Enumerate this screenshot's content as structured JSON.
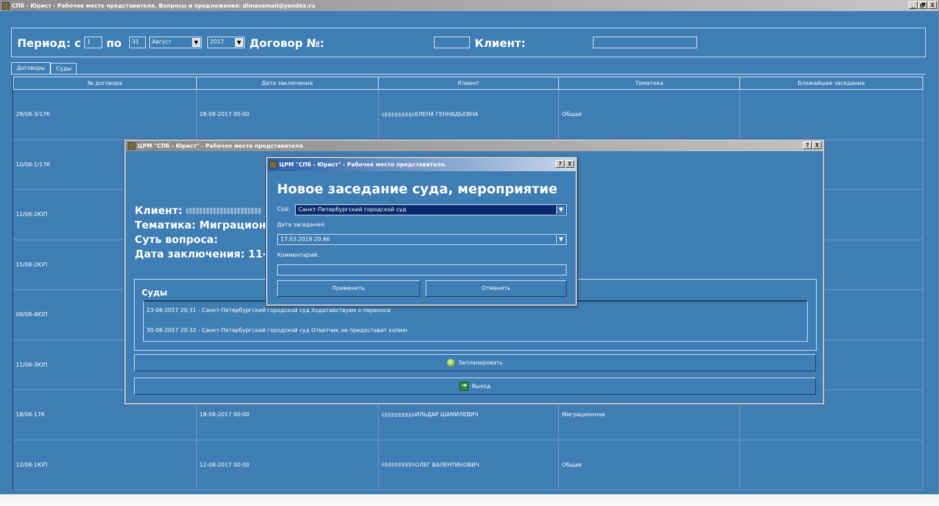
{
  "window": {
    "title": "СПб - Юрист - Рабочее место представителя. Вопросы и предложения: dimasemail@yandex.ru",
    "btn_min": "_",
    "btn_max": "🗗",
    "btn_close": "X"
  },
  "filter": {
    "period_from_label": "Период: с",
    "day_from": "1",
    "to_label": "по",
    "day_to": "31",
    "month": "Август",
    "year": "2017",
    "contract_label": "Договор №:",
    "contract_value": "",
    "client_label": "Клиент:",
    "client_value": ""
  },
  "tabs": [
    {
      "label": "Договоры",
      "active": true
    },
    {
      "label": "Суды",
      "active": false
    }
  ],
  "grid": {
    "columns": [
      "№ договора",
      "Дата заключения",
      "Клиент",
      "Тематика",
      "Ближайшее заседание"
    ],
    "rows": [
      {
        "num": "28/08-3/17К",
        "date": "28-08-2017 00:00",
        "client": "ЕЛЕНА ГЕННАДЬЕВНА",
        "topic": "Общая",
        "next": ""
      },
      {
        "num": "10/08-1/17К",
        "date": "",
        "client": "",
        "topic": "",
        "next": ""
      },
      {
        "num": "11/08-2ЮП",
        "date": "",
        "client": "",
        "topic": "",
        "next": ""
      },
      {
        "num": "15/08-2ЮП",
        "date": "",
        "client": "",
        "topic": "",
        "next": ""
      },
      {
        "num": "08/08-4ЮП",
        "date": "",
        "client": "",
        "topic": "",
        "next": ""
      },
      {
        "num": "11/08-3ЮП",
        "date": "",
        "client": "",
        "topic": "",
        "next": ""
      },
      {
        "num": "18/08-17К",
        "date": "18-08-2017 00:00",
        "client": "ИЛЬДАР ШАМИЛЕВИЧ",
        "topic": "Миграционное",
        "next": ""
      },
      {
        "num": "12/08-1ЮП",
        "date": "12-08-2017 00:00",
        "client": "ОЛЕГ ВАЛЕНТИНОВИЧ",
        "topic": "Общая",
        "next": ""
      }
    ]
  },
  "dialog1": {
    "title": "ЦРМ \"СПб - Юрист\" - Рабочее место представителя.",
    "btn_help": "?",
    "btn_close": "X",
    "client_label": "Клиент:",
    "topic_line": "Тематика: Миграцион",
    "question_line": "Суть вопроса:",
    "date_line": "Дата заключения: 11-",
    "courts_title": "Суды",
    "courts": [
      "23-08-2017 20:31 - Санкт-Петербургский городской суд Ходатайствуем о переносе",
      "30-08-2017 20:32 - Санкт-Петербургский городской суд Ответчик не предоставит копию"
    ],
    "plan_button": "Запланировать",
    "exit_button": "Выход"
  },
  "dialog2": {
    "title": "ЦРМ \"СПб - Юрист\" - Рабочее место представителя.",
    "btn_help": "?",
    "btn_close": "X",
    "heading": "Новое заседание суда, мероприятие",
    "court_label": "Суд:",
    "court_value": "Санкт-Петербургский городской суд",
    "date_label": "Дата заседания:",
    "date_value": "17.03.2018 20:46",
    "comment_label": "Комментарий:",
    "comment_value": "",
    "apply_button": "Применить",
    "cancel_button": "Отменить"
  }
}
